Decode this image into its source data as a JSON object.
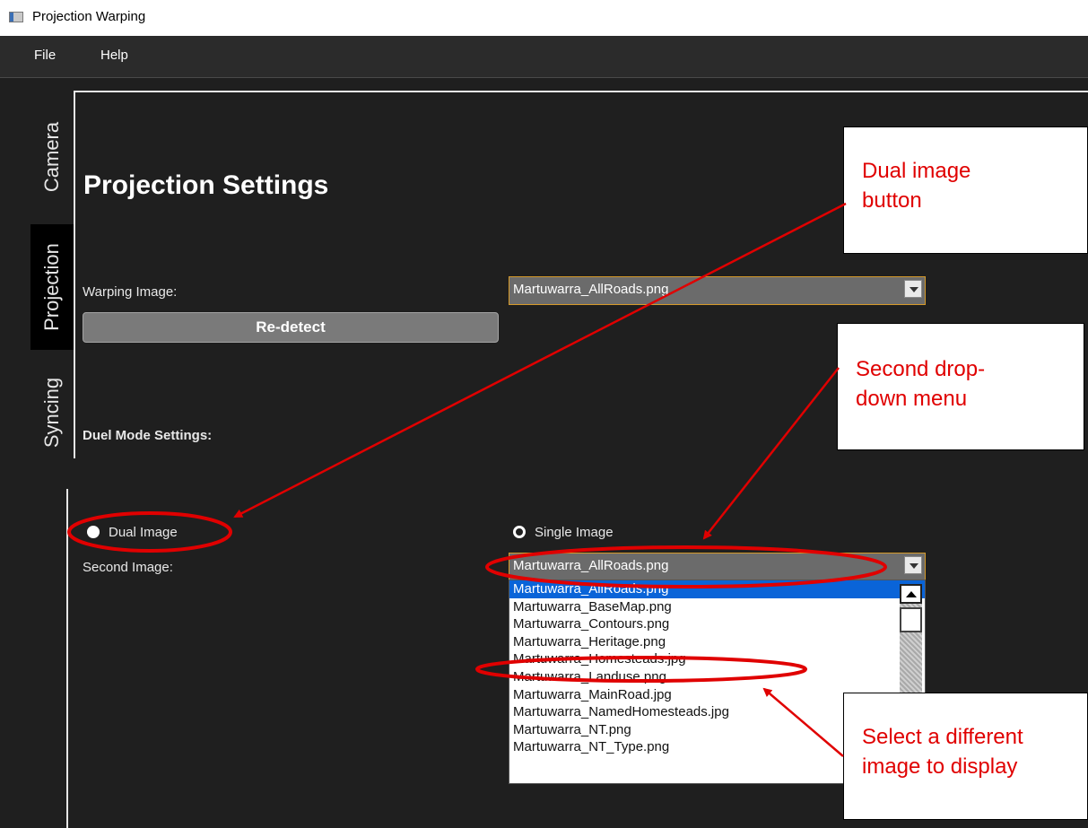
{
  "window": {
    "title": "Projection Warping"
  },
  "menu": {
    "file": "File",
    "help": "Help"
  },
  "tabs": {
    "camera": "Camera",
    "projection": "Projection",
    "syncing": "Syncing"
  },
  "panel": {
    "heading": "Projection Settings",
    "warping_label": "Warping Image:",
    "warping_value": "Martuwarra_AllRoads.png",
    "redetect": "Re-detect",
    "duel_heading": "Duel Mode Settings:",
    "dual_image": "Dual Image",
    "single_image": "Single Image",
    "second_label": "Second Image:",
    "second_value": "Martuwarra_AllRoads.png",
    "options": [
      "Martuwarra_AllRoads.png",
      "Martuwarra_BaseMap.png",
      "Martuwarra_Contours.png",
      "Martuwarra_Heritage.png",
      "Martuwarra_Homesteads.jpg",
      "Martuwarra_Landuse.png",
      "Martuwarra_MainRoad.jpg",
      "Martuwarra_NamedHomesteads.jpg",
      "Martuwarra_NT.png",
      "Martuwarra_NT_Type.png"
    ]
  },
  "annotations": {
    "dual_button": [
      "Dual image",
      "button"
    ],
    "second_dropdown": [
      "Second drop-",
      "down menu"
    ],
    "select_image": [
      "Select a different",
      "image to display"
    ]
  },
  "colors": {
    "annotation_red": "#e00000",
    "selection_blue": "#0a64d8",
    "combo_border": "#d59a2a"
  }
}
